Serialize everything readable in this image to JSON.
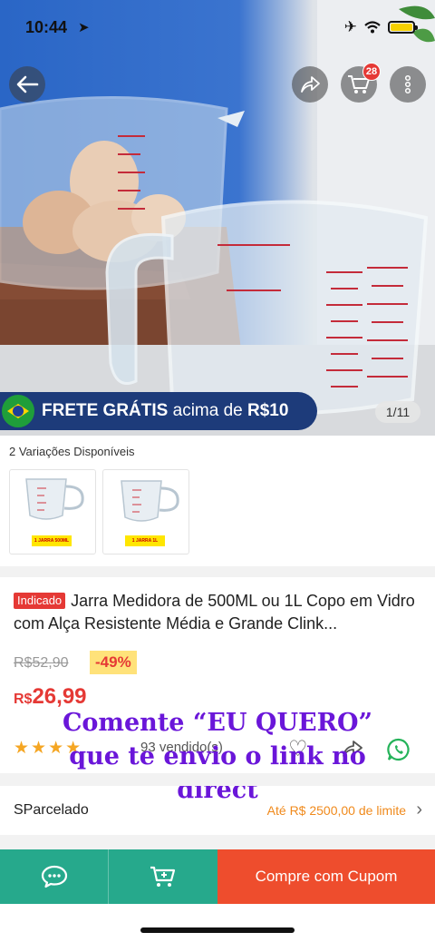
{
  "status_bar": {
    "time": "10:44",
    "location_icon": "location-arrow-icon",
    "battery_color": "#f5d000"
  },
  "header": {
    "cart_badge": "28"
  },
  "hero": {
    "shipping_banner_bold": "FRETE GRÁTIS",
    "shipping_banner_rest": " acima de ",
    "shipping_banner_amount": "R$10",
    "image_counter": "1/11"
  },
  "variations": {
    "title": "2 Variações Disponíveis",
    "items": [
      {
        "label": "1 JARRA 500ML"
      },
      {
        "label": "1 JARRA 1L"
      }
    ]
  },
  "product": {
    "tag": "Indicado",
    "title": "Jarra Medidora de 500ML ou 1L Copo em Vidro com Alça Resistente Média e Grande Clink...",
    "old_price": "R$52,90",
    "discount": "-49%",
    "price_currency": "R$",
    "price_value": "26,99",
    "rating_stars": 4,
    "sold_text": "93 vendido(s)"
  },
  "overlay": {
    "caption": "Comente “EU QUERO” que te envio o link no direct"
  },
  "parcel": {
    "label": "SParcelado",
    "limit": "Até R$ 2500,00 de limite"
  },
  "bottom_bar": {
    "buy_label": "Compre com Cupom"
  },
  "colors": {
    "accent_red": "#e53935",
    "teal": "#26a98c",
    "buy_orange": "#ee4d2d",
    "overlay_purple": "#6a16d9"
  }
}
